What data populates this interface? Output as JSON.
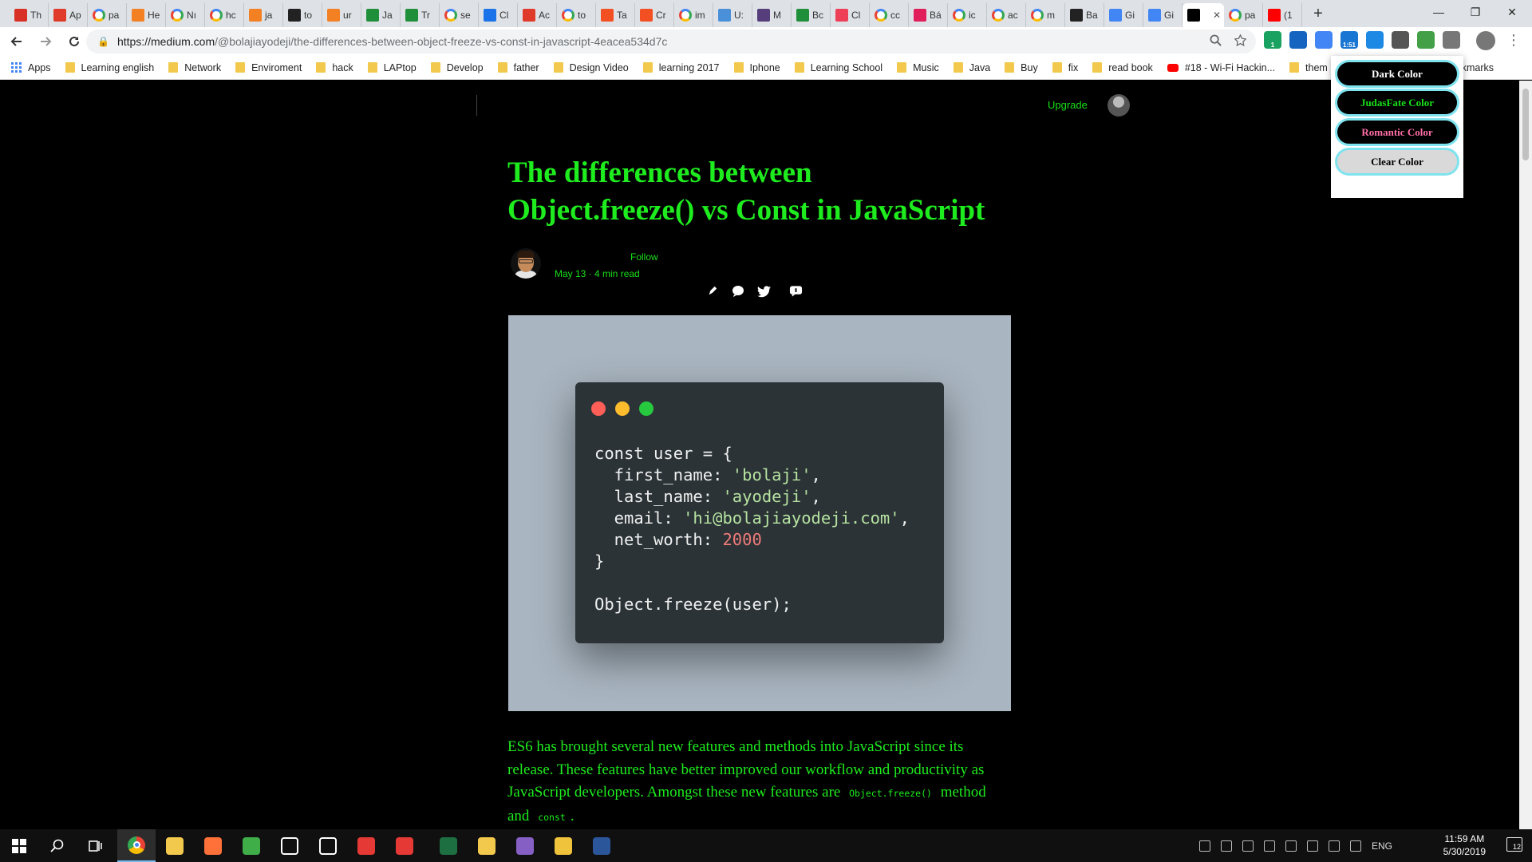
{
  "browser": {
    "tabs": [
      {
        "label": "Th",
        "icon": "gmail-like",
        "color": "#d93025"
      },
      {
        "label": "Ap",
        "icon": "stack",
        "color": "#e03a2b"
      },
      {
        "label": "pa",
        "icon": "chrome",
        "color": "#4285f4"
      },
      {
        "label": "He",
        "icon": "stack",
        "color": "#f48024"
      },
      {
        "label": "Nı",
        "icon": "chrome",
        "color": "#4285f4"
      },
      {
        "label": "hc",
        "icon": "chrome",
        "color": "#4285f4"
      },
      {
        "label": "ja",
        "icon": "stack",
        "color": "#f48024"
      },
      {
        "label": "to",
        "icon": "github",
        "color": "#222222"
      },
      {
        "label": "ur",
        "icon": "stack",
        "color": "#f48024"
      },
      {
        "label": "Ja",
        "icon": "sheet",
        "color": "#1f8f3a"
      },
      {
        "label": "Tr",
        "icon": "sheet",
        "color": "#1f8f3a"
      },
      {
        "label": "se",
        "icon": "chrome",
        "color": "#4285f4"
      },
      {
        "label": "Cl",
        "icon": "medium",
        "color": "#1a73e8"
      },
      {
        "label": "Ac",
        "icon": "stack",
        "color": "#e03a2b"
      },
      {
        "label": "to",
        "icon": "chrome",
        "color": "#4285f4"
      },
      {
        "label": "Ta",
        "icon": "ms",
        "color": "#f25022"
      },
      {
        "label": "Cr",
        "icon": "ms",
        "color": "#f25022"
      },
      {
        "label": "im",
        "icon": "chrome",
        "color": "#4285f4"
      },
      {
        "label": "U:",
        "icon": "globe",
        "color": "#4a90d9"
      },
      {
        "label": "M",
        "icon": "bootstrap",
        "color": "#563d7c"
      },
      {
        "label": "Bc",
        "icon": "sheet",
        "color": "#1f8f3a"
      },
      {
        "label": "Cl",
        "icon": "pocket",
        "color": "#ef3f56"
      },
      {
        "label": "cc",
        "icon": "chrome",
        "color": "#4285f4"
      },
      {
        "label": "Bá",
        "icon": "slack",
        "color": "#e01e5a"
      },
      {
        "label": "ic",
        "icon": "chrome",
        "color": "#4285f4"
      },
      {
        "label": "ac",
        "icon": "chrome",
        "color": "#4285f4"
      },
      {
        "label": "m",
        "icon": "chrome",
        "color": "#4285f4"
      },
      {
        "label": "Ba",
        "icon": "github",
        "color": "#222222"
      },
      {
        "label": "Gi",
        "icon": "translate",
        "color": "#4285f4"
      },
      {
        "label": "Gi",
        "icon": "translate",
        "color": "#4285f4"
      },
      {
        "label": "",
        "icon": "medium",
        "color": "#000000",
        "active": true
      },
      {
        "label": "pa",
        "icon": "chrome",
        "color": "#4285f4"
      },
      {
        "label": "(1",
        "icon": "youtube",
        "color": "#ff0000"
      }
    ],
    "tab_close": "✕",
    "new_tab": "+",
    "window": {
      "minimize": "—",
      "restore": "❐",
      "close": "✕"
    },
    "url_host": "https://medium.com",
    "url_path": "/@bolajiayodeji/the-differences-between-object-freeze-vs-const-in-javascript-4eacea534d7c",
    "extensions": [
      {
        "name": "ext-green",
        "color": "#1aa260",
        "badge": "1"
      },
      {
        "name": "ext-j",
        "color": "#1565c0",
        "badge": ""
      },
      {
        "name": "ext-translate",
        "color": "#4285f4",
        "badge": ""
      },
      {
        "name": "ext-timer",
        "color": "#1976d2",
        "badge": "1:51"
      },
      {
        "name": "ext-pen",
        "color": "#1e88e5",
        "badge": ""
      },
      {
        "name": "ext-settings",
        "color": "#555555",
        "badge": ""
      },
      {
        "name": "ext-leaf",
        "color": "#43a047",
        "badge": ""
      },
      {
        "name": "ext-shield",
        "color": "#777777",
        "badge": ""
      }
    ]
  },
  "bookmarks": {
    "items": [
      {
        "label": "Apps",
        "type": "apps"
      },
      {
        "label": "Learning english",
        "type": "folder"
      },
      {
        "label": "Network",
        "type": "folder"
      },
      {
        "label": "Enviroment",
        "type": "folder"
      },
      {
        "label": "hack",
        "type": "folder"
      },
      {
        "label": "LAPtop",
        "type": "folder"
      },
      {
        "label": "Develop",
        "type": "folder"
      },
      {
        "label": "father",
        "type": "folder"
      },
      {
        "label": "Design Video",
        "type": "folder"
      },
      {
        "label": "learning 2017",
        "type": "folder"
      },
      {
        "label": "Iphone",
        "type": "folder"
      },
      {
        "label": "Learning School",
        "type": "folder"
      },
      {
        "label": "Music",
        "type": "folder"
      },
      {
        "label": "Java",
        "type": "folder"
      },
      {
        "label": "Buy",
        "type": "folder"
      },
      {
        "label": "fix",
        "type": "folder"
      },
      {
        "label": "read book",
        "type": "folder"
      },
      {
        "label": "#18 - Wi-Fi Hackin...",
        "type": "youtube"
      },
      {
        "label": "them",
        "type": "folder"
      }
    ],
    "other": "er bookmarks"
  },
  "page": {
    "upgrade": "Upgrade",
    "title_line1": "The differences between",
    "title_line2": "Object.freeze() vs Const in JavaScript",
    "follow": "Follow",
    "meta": "May 13 · 4 min read",
    "share_icons": [
      "pen-icon",
      "comment-icon",
      "twitter-icon",
      "response-icon"
    ],
    "code": {
      "dots": [
        "#ff5f56",
        "#ffbd2e",
        "#27c93f"
      ],
      "line1": "const user = {",
      "line2_key": "  first_name: ",
      "line2_val": "'bolaji'",
      "line3_key": "  last_name: ",
      "line3_val": "'ayodeji'",
      "line4_key": "  email: ",
      "line4_val": "'hi@bolajiayodeji.com'",
      "line5_key": "  net_worth: ",
      "line5_val": "2000",
      "line6": "}",
      "line8": "Object.freeze(user);"
    },
    "body_part1": "ES6 has brought several new features and methods into JavaScript since its release. These features have better improved our workflow and productivity as JavaScript developers. Amongst these new features are",
    "body_code1": "Object.freeze()",
    "body_part2": "method and",
    "body_code2": "const",
    "body_part3": "."
  },
  "popup": {
    "buttons": [
      {
        "label": "Dark Color",
        "bg": "#000000",
        "fg": "#ffffff"
      },
      {
        "label": "JudasFate Color",
        "bg": "#000000",
        "fg": "#18e018"
      },
      {
        "label": "Romantic Color",
        "bg": "#000000",
        "fg": "#ff6fa8"
      },
      {
        "label": "Clear Color",
        "bg": "#d9d9d9",
        "fg": "#000000"
      }
    ]
  },
  "taskbar": {
    "apps": [
      {
        "name": "start",
        "color": "#ffffff"
      },
      {
        "name": "search",
        "color": "#ffffff"
      },
      {
        "name": "task-view",
        "color": "#ffffff"
      },
      {
        "name": "chrome",
        "color": "#4285f4"
      },
      {
        "name": "file-explorer",
        "color": "#f2c94c"
      },
      {
        "name": "firefox",
        "color": "#ff7139"
      },
      {
        "name": "green-app",
        "color": "#3fae49"
      },
      {
        "name": "store",
        "color": "#ffffff"
      },
      {
        "name": "mail",
        "color": "#ffffff"
      },
      {
        "name": "red-app-1",
        "color": "#e53935"
      },
      {
        "name": "red-app-2",
        "color": "#e53935"
      },
      {
        "name": "excel",
        "color": "#1d6f42"
      },
      {
        "name": "notepad-app",
        "color": "#f2c94c"
      },
      {
        "name": "visual-studio",
        "color": "#865fc5"
      },
      {
        "name": "git-app",
        "color": "#f0c33c"
      },
      {
        "name": "word",
        "color": "#2b579a"
      }
    ],
    "language": "ENG",
    "time": "11:59 AM",
    "date": "5/30/2019",
    "notifications": "12"
  }
}
